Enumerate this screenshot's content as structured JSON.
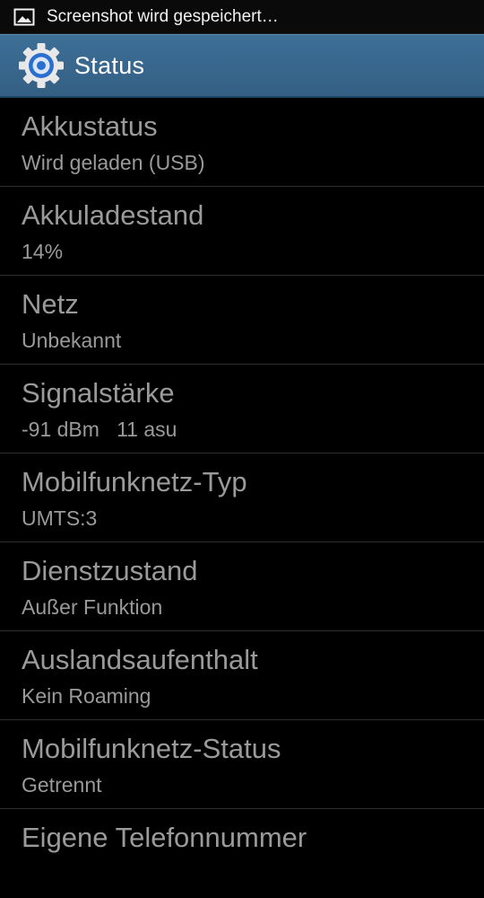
{
  "status_bar": {
    "notification_icon": "image-icon",
    "notification_text": "Screenshot wird gespeichert…"
  },
  "action_bar": {
    "icon": "gear-icon",
    "title": "Status",
    "accent_color": "#3a6a91"
  },
  "items": [
    {
      "label": "Akkustatus",
      "value": "Wird geladen (USB)"
    },
    {
      "label": "Akkuladestand",
      "value": "14%"
    },
    {
      "label": "Netz",
      "value": "Unbekannt"
    },
    {
      "label": "Signalstärke",
      "value": "-91 dBm   11 asu"
    },
    {
      "label": "Mobilfunknetz-Typ",
      "value": "UMTS:3"
    },
    {
      "label": "Dienstzustand",
      "value": "Außer Funktion"
    },
    {
      "label": "Auslandsaufenthalt",
      "value": "Kein Roaming"
    },
    {
      "label": "Mobilfunknetz-Status",
      "value": "Getrennt"
    },
    {
      "label": "Eigene Telefonnummer",
      "value": ""
    }
  ]
}
